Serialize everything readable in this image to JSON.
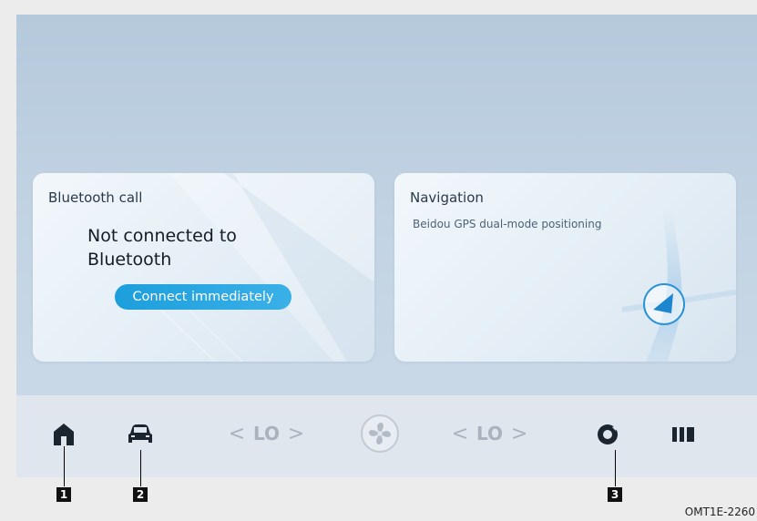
{
  "bluetooth_card": {
    "title": "Bluetooth call",
    "status": "Not connected to Bluetooth",
    "connect_button": "Connect immediately"
  },
  "navigation_card": {
    "title": "Navigation",
    "subtitle": "Beidou GPS dual-mode positioning"
  },
  "dock": {
    "left_temp": {
      "value": "LO",
      "decrease": "<",
      "increase": ">"
    },
    "right_temp": {
      "value": "LO",
      "decrease": "<",
      "increase": ">"
    },
    "icons": [
      "home-icon",
      "car-icon",
      "fan-icon",
      "settings-dial-icon",
      "apps-icon"
    ]
  },
  "callouts": [
    "1",
    "2",
    "3"
  ],
  "reference_code": "OMT1E-2260",
  "colors": {
    "accent": "#1c9fdc",
    "icon_dark": "#1b2530",
    "icon_muted": "#a9b3be"
  }
}
